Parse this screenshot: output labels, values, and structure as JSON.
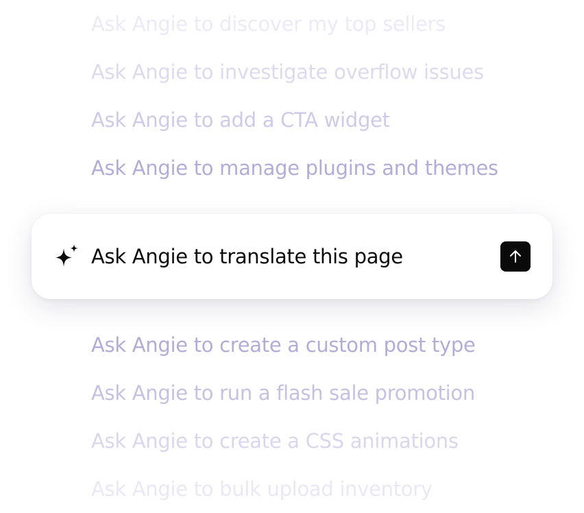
{
  "suggestions_above": [
    "Ask Angie to discover my top sellers",
    "Ask Angie to investigate overflow issues",
    "Ask Angie to add a CTA widget",
    "Ask Angie to manage plugins and themes"
  ],
  "prompt": {
    "text": "Ask Angie to translate this page",
    "sparkle_icon": "sparkle-icon",
    "send_icon": "arrow-up-icon"
  },
  "suggestions_below": [
    "Ask Angie to create a custom post type",
    "Ask Angie to run a flash sale promotion",
    "Ask Angie to create a CSS animations",
    "Ask Angie to bulk upload inventory"
  ],
  "colors": {
    "suggestion_text": "#b3acd9",
    "prompt_text": "#0c0c0c",
    "send_button_bg": "#0a0a0a",
    "card_bg": "#ffffff"
  }
}
